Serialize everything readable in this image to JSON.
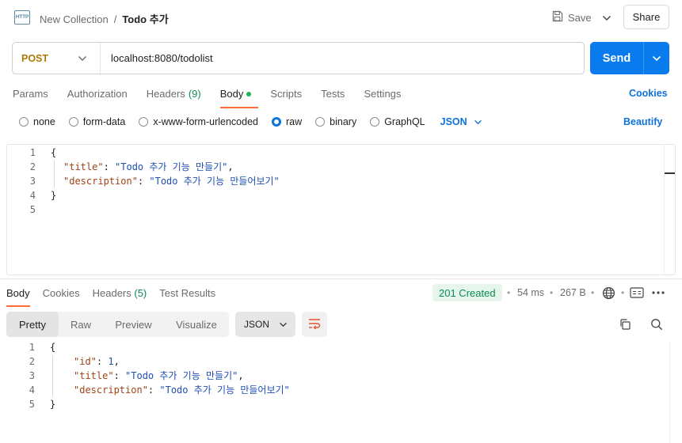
{
  "header": {
    "protocol_icon_text": "HTTP",
    "breadcrumb_collection": "New Collection",
    "breadcrumb_separator": "/",
    "breadcrumb_request": "Todo 추가",
    "save_label": "Save",
    "share_label": "Share"
  },
  "request": {
    "method": "POST",
    "url": "localhost:8080/todolist",
    "send_label": "Send",
    "tabs": [
      {
        "label": "Params"
      },
      {
        "label": "Authorization"
      },
      {
        "label": "Headers",
        "count": "(9)"
      },
      {
        "label": "Body"
      },
      {
        "label": "Scripts"
      },
      {
        "label": "Tests"
      },
      {
        "label": "Settings"
      }
    ],
    "cookies_label": "Cookies",
    "body_types": [
      "none",
      "form-data",
      "x-www-form-urlencoded",
      "raw",
      "binary",
      "GraphQL"
    ],
    "selected_body_type": "raw",
    "language": "JSON",
    "beautify_label": "Beautify",
    "line_numbers": [
      "1",
      "2",
      "3",
      "4",
      "5"
    ],
    "code": {
      "open": "{",
      "title_key": "\"title\"",
      "title_val": "\"Todo 추가 기능 만들기\"",
      "desc_key": "\"description\"",
      "desc_val": "\"Todo 추가 기능 만들어보기\"",
      "close": "}"
    }
  },
  "response": {
    "tabs": [
      {
        "label": "Body"
      },
      {
        "label": "Cookies"
      },
      {
        "label": "Headers",
        "count": "(5)"
      },
      {
        "label": "Test Results"
      }
    ],
    "status": "201 Created",
    "time": "54 ms",
    "size": "267 B",
    "view_modes": [
      "Pretty",
      "Raw",
      "Preview",
      "Visualize"
    ],
    "active_view": "Pretty",
    "format": "JSON",
    "line_numbers": [
      "1",
      "2",
      "3",
      "4",
      "5"
    ],
    "code": {
      "open": "{",
      "id_key": "\"id\"",
      "id_val": "1",
      "title_key": "\"title\"",
      "title_val": "\"Todo 추가 기능 만들기\"",
      "desc_key": "\"description\"",
      "desc_val": "\"Todo 추가 기능 만들어보기\"",
      "close": "}"
    }
  },
  "colors": {
    "accent_blue": "#097bed",
    "tab_underline": "#ff6c37",
    "method_post": "#ad7a03",
    "status_success": "#0c8a55"
  }
}
